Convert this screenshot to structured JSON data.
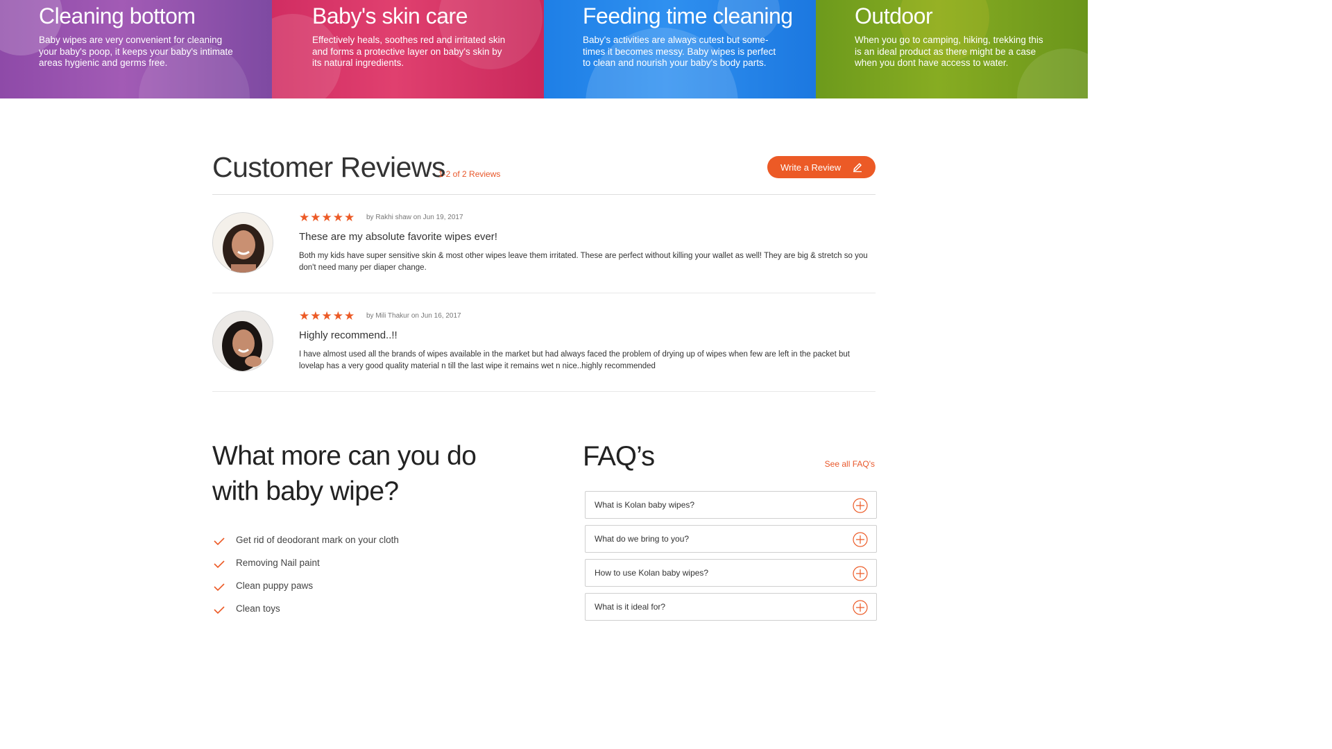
{
  "banner": {
    "panels": [
      {
        "title": "Cleaning bottom",
        "text": "Baby wipes are very convenient for cleaning your baby's poop, it keeps your baby's intimate areas hygienic and germs free."
      },
      {
        "title": "Baby's skin care",
        "text": "Effectively heals, soothes red and irritated skin and forms a protective layer on baby's skin by its natural ingredients."
      },
      {
        "title": "Feeding time cleaning",
        "text": "Baby's activities are always cutest but some-times it becomes messy. Baby wipes is perfect to clean and nourish your baby's body parts."
      },
      {
        "title": "Outdoor",
        "text": "When you go to camping, hiking, trekking this is an ideal product as there might be a case when you dont have access to water."
      }
    ]
  },
  "reviews": {
    "title": "Customer Reviews",
    "count": "1-2 of 2 Reviews",
    "write_label": "Write a Review",
    "items": [
      {
        "stars": "★★★★★",
        "rating": 5,
        "meta": "by Rakhi shaw on Jun 19, 2017",
        "title": "These are my absolute favorite wipes ever!",
        "body": "Both my kids have super sensitive skin & most other wipes leave them irritated. These are perfect without killing your wallet as well! They are big & stretch so you don't need many per diaper change."
      },
      {
        "stars": "★★★★★",
        "rating": 5,
        "meta": "by Mili Thakur on Jun 16, 2017",
        "title": "Highly recommend..!!",
        "body": "I have almost used all the brands of wipes available in the market but had always faced the problem of drying up of wipes when few are left in the packet but lovelap has a very good quality material n till the last wipe it remains wet n nice..highly recommended"
      }
    ]
  },
  "more": {
    "title_line1": "What more can you do",
    "title_line2": "with baby wipe?",
    "items": [
      "Get rid of deodorant mark on your cloth",
      "Removing Nail paint",
      "Clean puppy paws",
      "Clean toys"
    ]
  },
  "faq": {
    "title": "FAQ’s",
    "see_all": "See all FAQ's",
    "items": [
      "What is Kolan baby wipes?",
      "What do we bring to you?",
      "How to use Kolan baby wipes?",
      "What is it ideal for?"
    ]
  },
  "colors": {
    "accent": "#ec5a26",
    "panel_purple": "#9a55b0",
    "panel_pink": "#d8356a",
    "panel_blue": "#2688ec",
    "panel_green": "#7da320"
  }
}
